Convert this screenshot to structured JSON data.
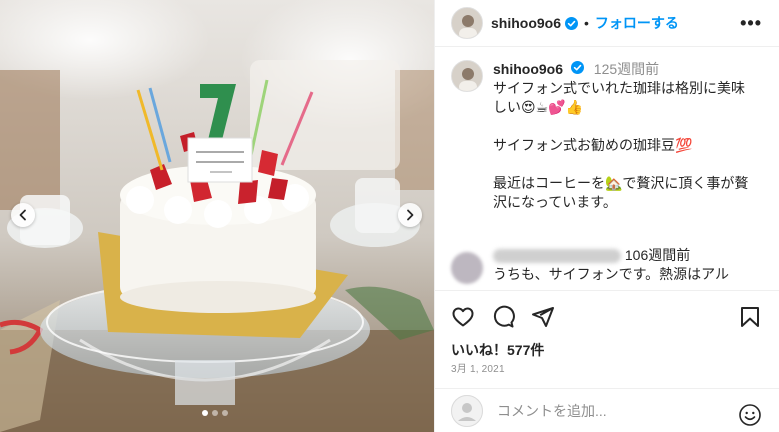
{
  "post": {
    "media_alt_icon": "birthday-cake-photo",
    "carousel_dots": 3,
    "active_dot": 0
  },
  "header": {
    "username": "shihoo9o6",
    "separator": "•",
    "follow_label": "フォローする",
    "more_label": "•••"
  },
  "caption": {
    "username": "shihoo9o6",
    "time": "125週間前",
    "lines": [
      "サイフォン式でいれた珈琲は格別に美味",
      "しい😍☕💕👍",
      "",
      "サイフォン式お勧めの珈琲豆💯",
      "",
      "最近はコーヒーを🏡で贅沢に頂く事が贅",
      "沢になっています。"
    ]
  },
  "comment2": {
    "time": "106週間前",
    "text": "うちも、サイフォンです。熱源はアル"
  },
  "actions": {
    "likes": "いいね！577件",
    "date": "3月 1, 2021"
  },
  "comment_box": {
    "placeholder": "コメントを追加..."
  },
  "colors": {
    "accent": "#0095f6",
    "text": "#262626",
    "muted": "#8e8e8e",
    "divider": "#efefef"
  }
}
